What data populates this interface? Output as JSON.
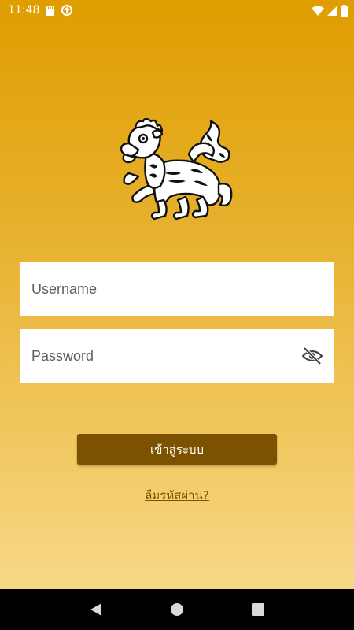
{
  "status_bar": {
    "time": "11:48",
    "icons": [
      "sd-card-icon",
      "data-saver-icon",
      "wifi-icon",
      "signal-icon",
      "battery-icon"
    ]
  },
  "logo": {
    "icon": "lion-emblem-icon"
  },
  "login_form": {
    "username_placeholder": "Username",
    "password_placeholder": "Password",
    "password_visibility_icon": "eye-off-icon",
    "login_label": "เข้าสู่ระบบ",
    "forgot_password_label": "ลืมรหัสผ่าน?"
  },
  "colors": {
    "gradient_top": "#df9d00",
    "gradient_bottom": "#f8d886",
    "button": "#7c5100",
    "link": "#7c5100"
  },
  "nav_bar": {
    "icons": [
      "back-icon",
      "home-icon",
      "recents-icon"
    ]
  }
}
